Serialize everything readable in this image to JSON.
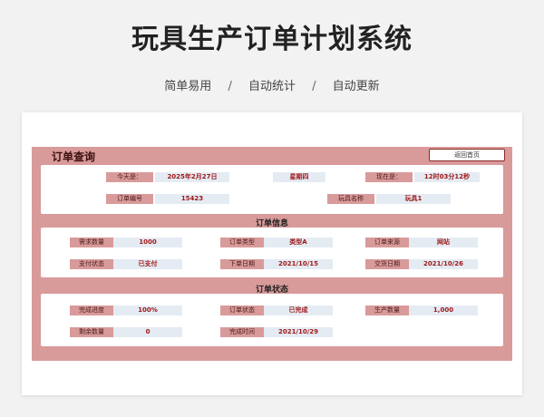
{
  "header": {
    "title": "玩具生产订单计划系统",
    "features": [
      "简单易用",
      "自动统计",
      "自动更新"
    ],
    "separator": "/"
  },
  "query": {
    "title": "订单查询",
    "home_button": "返回首页",
    "today_label": "今天是：",
    "today_value": "2025年2月27日",
    "weekday_value": "星期四",
    "now_label": "现在是：",
    "now_value": "12时03分12秒",
    "order_no_label": "订单编号",
    "order_no_value": "15423",
    "toy_name_label": "玩具名称",
    "toy_name_value": "玩具1"
  },
  "info": {
    "title": "订单信息",
    "demand_label": "需求数量",
    "demand_value": "1000",
    "type_label": "订单类型",
    "type_value": "类型A",
    "source_label": "订单来源",
    "source_value": "网站",
    "pay_label": "支付状态",
    "pay_value": "已支付",
    "order_date_label": "下单日期",
    "order_date_value": "2021/10/15",
    "delivery_label": "交货日期",
    "delivery_value": "2021/10/26"
  },
  "status": {
    "title": "订单状态",
    "progress_label": "完成进度",
    "progress_value": "100%",
    "state_label": "订单状态",
    "state_value": "已完成",
    "produced_label": "生产数量",
    "produced_value": "1,000",
    "remain_label": "剩余数量",
    "remain_value": "0",
    "finish_label": "完成时间",
    "finish_value": "2021/10/29"
  }
}
